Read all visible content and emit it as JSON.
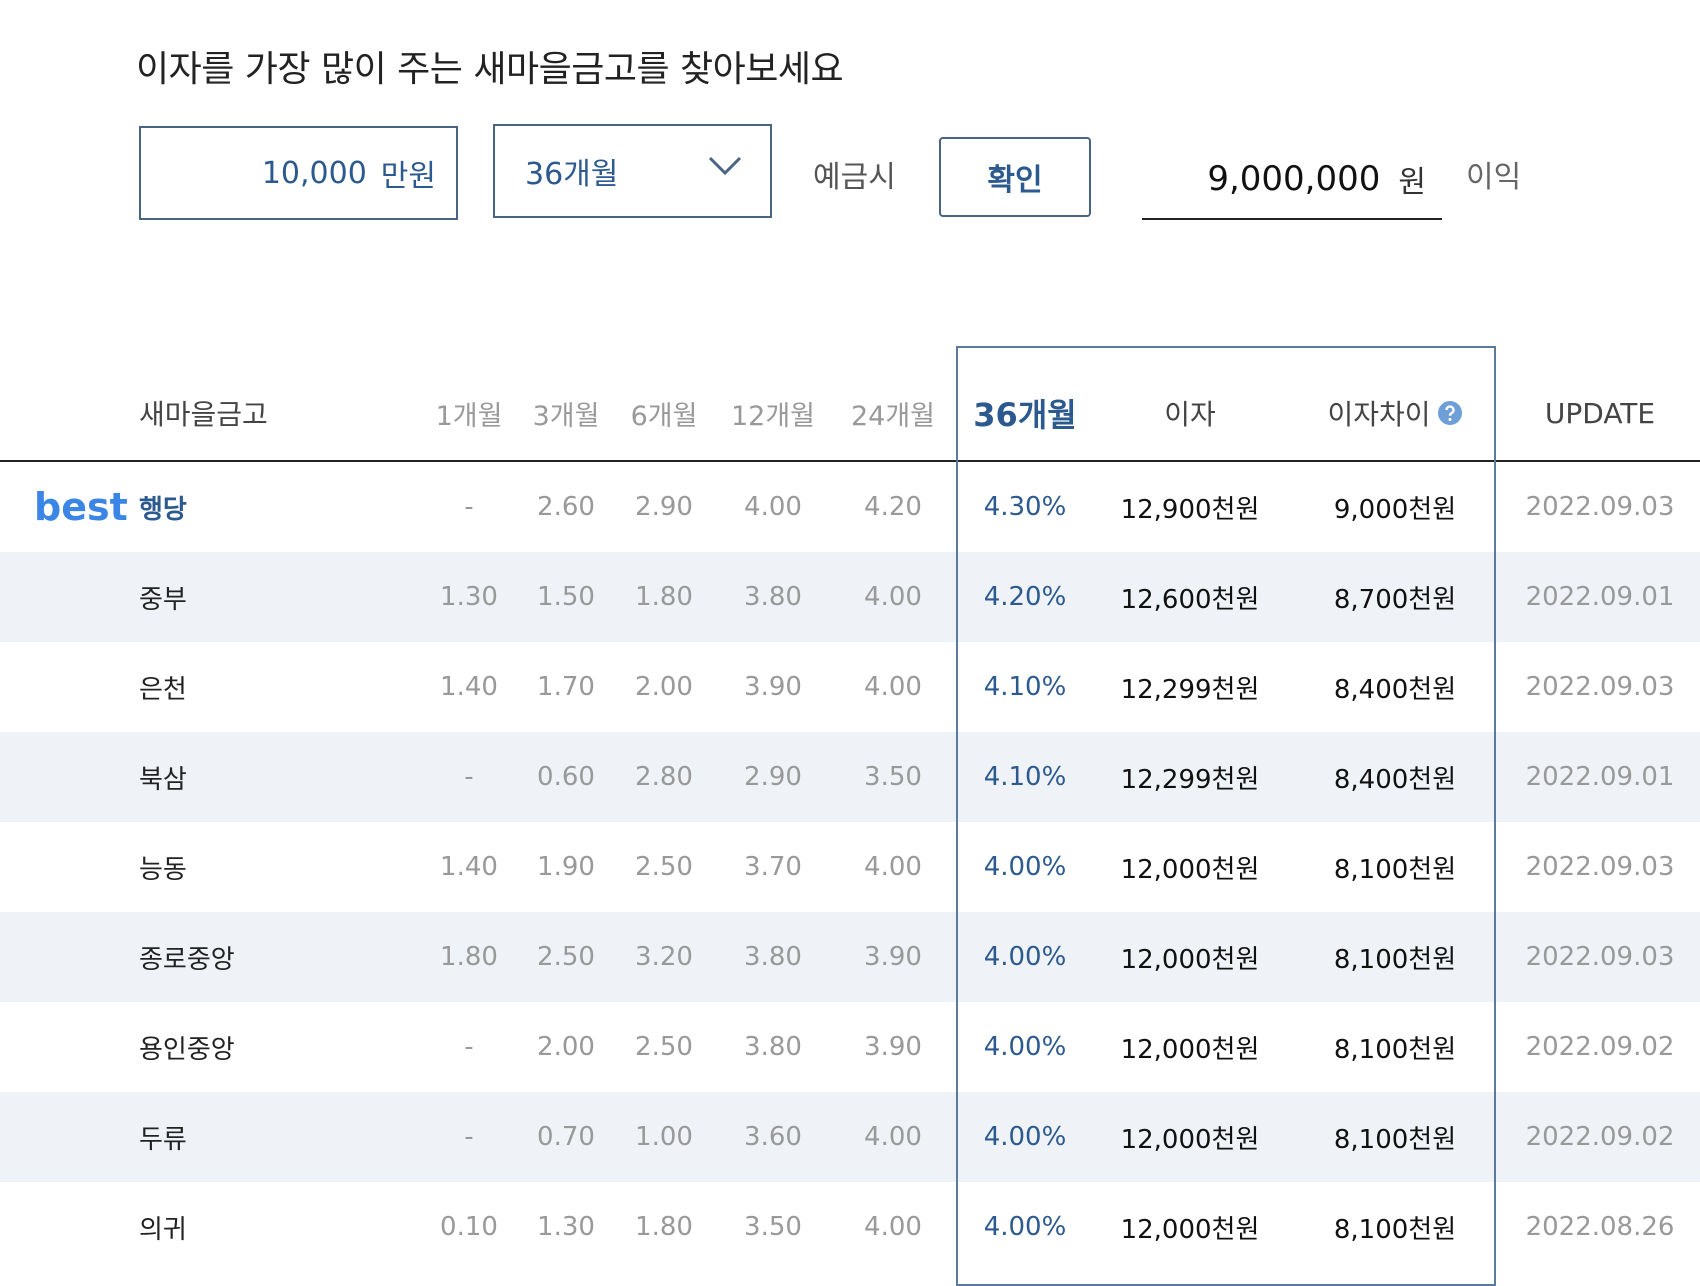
{
  "title": "이자를 가장 많이 주는 새마을금고를 찾아보세요",
  "form": {
    "amount_value": "10,000",
    "amount_unit": "만원",
    "period_selected": "36개월",
    "deposit_label": "예금시",
    "confirm_label": "확인",
    "result_value": "9,000,000",
    "result_unit": "원",
    "profit_label": "이익"
  },
  "table": {
    "headers": {
      "name": "새마을금고",
      "m1": "1개월",
      "m3": "3개월",
      "m6": "6개월",
      "m12": "12개월",
      "m24": "24개월",
      "m36": "36개월",
      "interest": "이자",
      "diff": "이자차이",
      "update": "UPDATE"
    },
    "best_label": "best",
    "rows": [
      {
        "name": "행당",
        "m1": "-",
        "m3": "2.60",
        "m6": "2.90",
        "m12": "4.00",
        "m24": "4.20",
        "m36": "4.30%",
        "interest": "12,900천원",
        "diff": "9,000천원",
        "update": "2022.09.03"
      },
      {
        "name": "중부",
        "m1": "1.30",
        "m3": "1.50",
        "m6": "1.80",
        "m12": "3.80",
        "m24": "4.00",
        "m36": "4.20%",
        "interest": "12,600천원",
        "diff": "8,700천원",
        "update": "2022.09.01"
      },
      {
        "name": "은천",
        "m1": "1.40",
        "m3": "1.70",
        "m6": "2.00",
        "m12": "3.90",
        "m24": "4.00",
        "m36": "4.10%",
        "interest": "12,299천원",
        "diff": "8,400천원",
        "update": "2022.09.03"
      },
      {
        "name": "북삼",
        "m1": "-",
        "m3": "0.60",
        "m6": "2.80",
        "m12": "2.90",
        "m24": "3.50",
        "m36": "4.10%",
        "interest": "12,299천원",
        "diff": "8,400천원",
        "update": "2022.09.01"
      },
      {
        "name": "능동",
        "m1": "1.40",
        "m3": "1.90",
        "m6": "2.50",
        "m12": "3.70",
        "m24": "4.00",
        "m36": "4.00%",
        "interest": "12,000천원",
        "diff": "8,100천원",
        "update": "2022.09.03"
      },
      {
        "name": "종로중앙",
        "m1": "1.80",
        "m3": "2.50",
        "m6": "3.20",
        "m12": "3.80",
        "m24": "3.90",
        "m36": "4.00%",
        "interest": "12,000천원",
        "diff": "8,100천원",
        "update": "2022.09.03"
      },
      {
        "name": "용인중앙",
        "m1": "-",
        "m3": "2.00",
        "m6": "2.50",
        "m12": "3.80",
        "m24": "3.90",
        "m36": "4.00%",
        "interest": "12,000천원",
        "diff": "8,100천원",
        "update": "2022.09.02"
      },
      {
        "name": "두류",
        "m1": "-",
        "m3": "0.70",
        "m6": "1.00",
        "m12": "3.60",
        "m24": "4.00",
        "m36": "4.00%",
        "interest": "12,000천원",
        "diff": "8,100천원",
        "update": "2022.09.02"
      },
      {
        "name": "의귀",
        "m1": "0.10",
        "m3": "1.30",
        "m6": "1.80",
        "m12": "3.50",
        "m24": "4.00",
        "m36": "4.00%",
        "interest": "12,000천원",
        "diff": "8,100천원",
        "update": "2022.08.26"
      }
    ]
  },
  "colors": {
    "accent": "#2c5a8f",
    "best": "#3a85e6",
    "row_alt": "#eff3f8",
    "help_icon": "#6f9fd8"
  },
  "icons": {
    "dropdown": "chevron-down-icon",
    "help": "question-circle-icon"
  }
}
